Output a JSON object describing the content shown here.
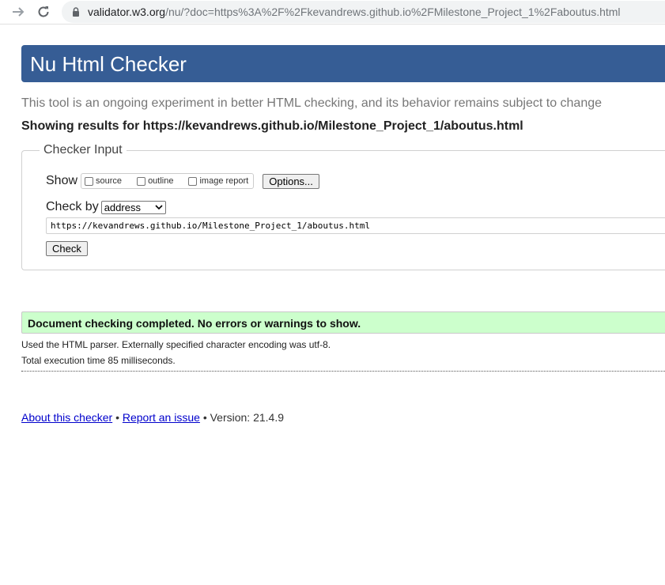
{
  "browser": {
    "url_host": "validator.w3.org",
    "url_path": "/nu/?doc=https%3A%2F%2Fkevandrews.github.io%2FMilestone_Project_1%2Faboutus.html",
    "icons": [
      "forward-icon",
      "reload-icon",
      "lock-icon"
    ]
  },
  "header": {
    "title": "Nu Html Checker"
  },
  "intro": "This tool is an ongoing experiment in better HTML checking, and its behavior remains subject to change",
  "results_line": "Showing results for https://kevandrews.github.io/Milestone_Project_1/aboutus.html",
  "checker_input": {
    "legend": "Checker Input",
    "show_label": "Show",
    "show_options": [
      "source",
      "outline",
      "image report"
    ],
    "options_button": "Options...",
    "check_by_label": "Check by",
    "check_by_value": "address",
    "address_value": "https://kevandrews.github.io/Milestone_Project_1/aboutus.html",
    "check_button": "Check"
  },
  "status": {
    "message": "Document checking completed. No errors or warnings to show.",
    "color": "#ccffcc"
  },
  "details": {
    "parser": "Used the HTML parser. Externally specified character encoding was utf-8.",
    "time": "Total execution time 85 milliseconds."
  },
  "footer": {
    "about_link": "About this checker",
    "separator": "•",
    "report_link": "Report an issue",
    "version": "• Version: 21.4.9"
  },
  "colors": {
    "banner": "#365d95",
    "link": "#0000cc"
  }
}
